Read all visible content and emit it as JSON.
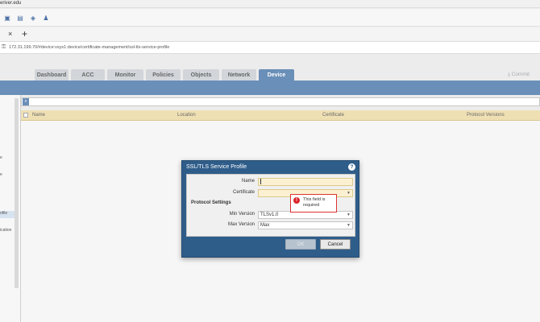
{
  "window": {
    "title_fragment": "eriver.edu"
  },
  "browser": {
    "url": "172.31.199.70/#device:vsys1:device/certificate-management/ssl-tls-service-profile",
    "tab_close": "×",
    "tab_new": "+"
  },
  "nav": {
    "tabs": [
      "Dashboard",
      "ACC",
      "Monitor",
      "Policies",
      "Objects",
      "Network",
      "Device"
    ],
    "active": "Device",
    "commit_label": "Commit"
  },
  "sidebar": {
    "items": [
      "e",
      "e",
      "ofile",
      "ication"
    ]
  },
  "table": {
    "columns": [
      "Name",
      "Location",
      "Certificate",
      "Protocol Versions"
    ]
  },
  "dialog": {
    "title": "SSL/TLS Service Profile",
    "help_icon": "?",
    "fields": {
      "name_label": "Name",
      "name_value": "",
      "certificate_label": "Certificate",
      "certificate_value": "",
      "protocol_settings_label": "Protocol Settings",
      "min_version_label": "Min Version",
      "min_version_value": "TLSv1.0",
      "max_version_label": "Max Version",
      "max_version_value": "Max"
    },
    "error": {
      "icon": "!",
      "line1": "This field is",
      "line2": "required"
    },
    "buttons": {
      "ok": "OK",
      "cancel": "Cancel"
    }
  },
  "colors": {
    "accent": "#6a8fb8",
    "dialog_header": "#2f5d8a",
    "table_header": "#efe0b4",
    "error": "#d9252a"
  }
}
